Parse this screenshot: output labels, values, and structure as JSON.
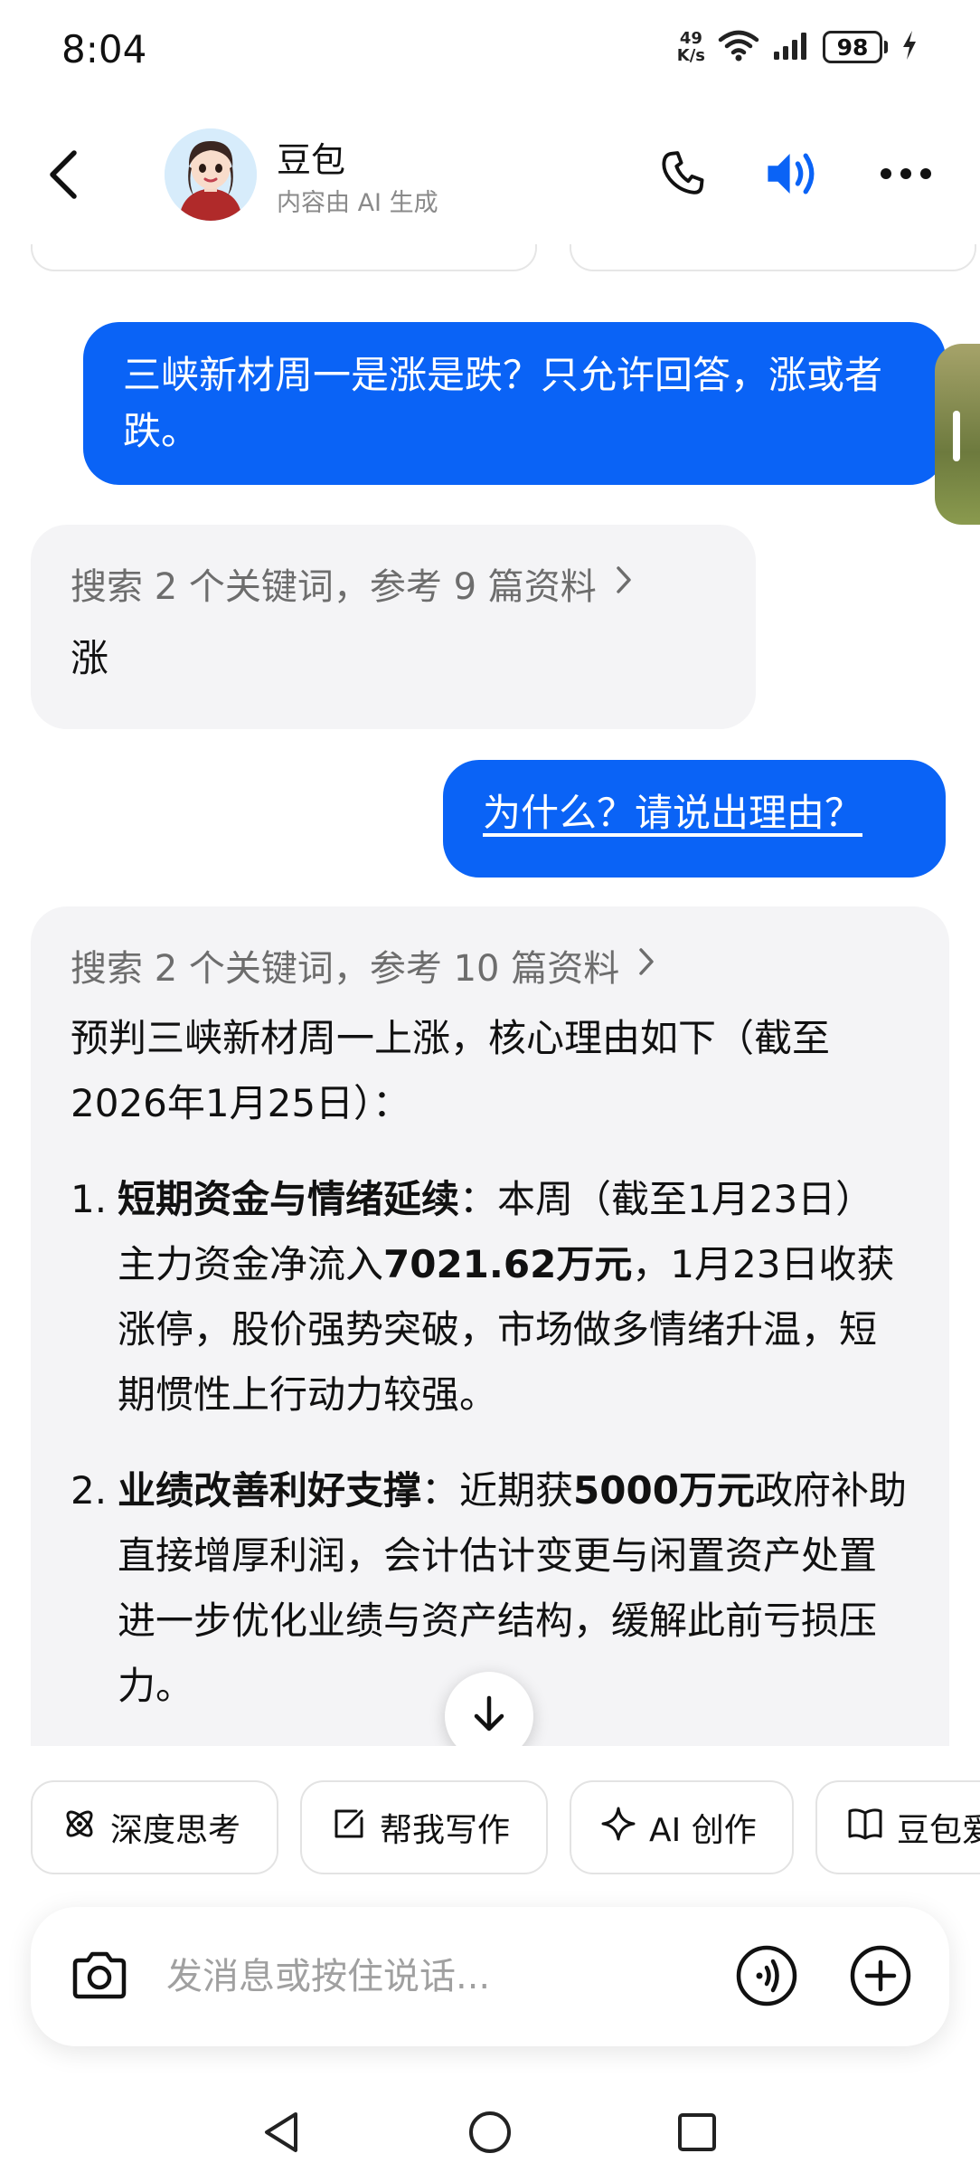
{
  "status_bar": {
    "time": "8:04",
    "net_speed_value": "49",
    "net_speed_unit": "K/s",
    "battery": "98"
  },
  "header": {
    "contact_name": "豆包",
    "contact_subtitle": "内容由 AI 生成",
    "icons": [
      "back-icon",
      "phone-icon",
      "speaker-icon",
      "more-icon"
    ],
    "accent_color": "#0a63f6"
  },
  "messages": [
    {
      "role": "user",
      "text": "三峡新材周一是涨是跌？只允许回答，涨或者跌。"
    },
    {
      "role": "assistant",
      "search_summary": "搜索 2 个关键词，参考 9 篇资料",
      "text": "涨"
    },
    {
      "role": "user",
      "text": "为什么？请说出理由？"
    },
    {
      "role": "assistant",
      "search_summary": "搜索 2 个关键词，参考 10 篇资料",
      "intro": "预判三峡新材周一上涨，核心理由如下（截至2026年1月25日）：",
      "points": [
        {
          "number": "1.",
          "title": "短期资金与情绪延续",
          "text_a": "：本周（截至1月23日）主力资金净流入",
          "highlight": "7021.62万元",
          "text_b": "，1月23日收获涨停，股价强势突破，市场做多情绪升温，短期惯性上行动力较强。"
        },
        {
          "number": "2.",
          "title": "业绩改善利好支撑",
          "text_a": "：近期获",
          "highlight": "5000万元",
          "text_b": "政府补助直接增厚利润，会计估计变更与闲置资产处置进一步优化业绩与资产结构，缓解此前亏损压力。"
        }
      ]
    }
  ],
  "quick_actions": [
    {
      "label": "深度思考",
      "icon": "atom-icon"
    },
    {
      "label": "帮我写作",
      "icon": "edit-icon"
    },
    {
      "label": "AI 创作",
      "icon": "sparkle-icon"
    },
    {
      "label": "豆包爱",
      "icon": "book-icon"
    }
  ],
  "input": {
    "placeholder": "发消息或按住说话..."
  },
  "nav": [
    "back-triangle-icon",
    "home-circle-icon",
    "recents-square-icon"
  ]
}
